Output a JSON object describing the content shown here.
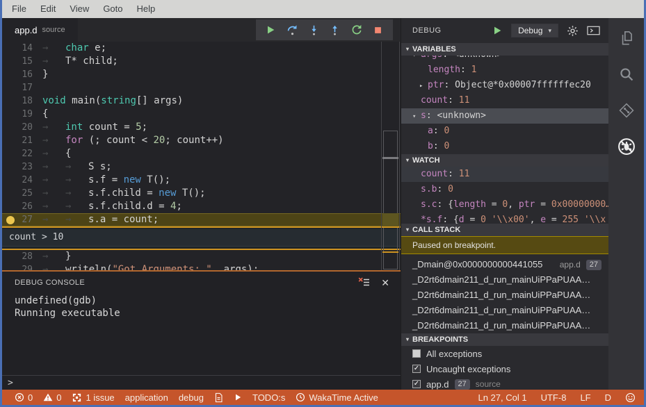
{
  "window": {
    "menu_items": [
      "File",
      "Edit",
      "View",
      "Goto",
      "Help"
    ]
  },
  "editor": {
    "tab": {
      "name": "app.d",
      "type": "source"
    },
    "tab_glyph": "→",
    "toolbar_buttons": [
      "continue",
      "step-over",
      "step-into",
      "step-out",
      "restart",
      "stop"
    ],
    "condition_widget": {
      "expression": "count > 10"
    },
    "code_lines": [
      {
        "num": 14,
        "indent": 1,
        "tokens": [
          {
            "t": "char",
            "c": "kw"
          },
          {
            "t": " e;",
            "c": "pl"
          }
        ]
      },
      {
        "num": 15,
        "indent": 1,
        "tokens": [
          {
            "t": "T* child;",
            "c": "pl"
          }
        ]
      },
      {
        "num": 16,
        "indent": 0,
        "tokens": [
          {
            "t": "}",
            "c": "pl"
          }
        ]
      },
      {
        "num": 17,
        "indent": 0,
        "tokens": []
      },
      {
        "num": 18,
        "indent": 0,
        "tokens": [
          {
            "t": "void",
            "c": "kw"
          },
          {
            "t": " main(",
            "c": "pl"
          },
          {
            "t": "string",
            "c": "kw"
          },
          {
            "t": "[] args)",
            "c": "pl"
          }
        ]
      },
      {
        "num": 19,
        "indent": 0,
        "tokens": [
          {
            "t": "{",
            "c": "pl"
          }
        ]
      },
      {
        "num": 20,
        "indent": 1,
        "tokens": [
          {
            "t": "int",
            "c": "kw"
          },
          {
            "t": " count = ",
            "c": "pl"
          },
          {
            "t": "5",
            "c": "num"
          },
          {
            "t": ";",
            "c": "pl"
          }
        ]
      },
      {
        "num": 21,
        "indent": 1,
        "tokens": [
          {
            "t": "for",
            "c": "ctrl"
          },
          {
            "t": " (; count < ",
            "c": "pl"
          },
          {
            "t": "20",
            "c": "num"
          },
          {
            "t": "; count++)",
            "c": "pl"
          }
        ]
      },
      {
        "num": 22,
        "indent": 1,
        "tokens": [
          {
            "t": "{",
            "c": "pl"
          }
        ]
      },
      {
        "num": 23,
        "indent": 2,
        "tokens": [
          {
            "t": "S s;",
            "c": "pl"
          }
        ]
      },
      {
        "num": 24,
        "indent": 2,
        "tokens": [
          {
            "t": "s.f = ",
            "c": "pl"
          },
          {
            "t": "new",
            "c": "new"
          },
          {
            "t": " T();",
            "c": "pl"
          }
        ]
      },
      {
        "num": 25,
        "indent": 2,
        "tokens": [
          {
            "t": "s.f.child = ",
            "c": "pl"
          },
          {
            "t": "new",
            "c": "new"
          },
          {
            "t": " T();",
            "c": "pl"
          }
        ]
      },
      {
        "num": 26,
        "indent": 2,
        "tokens": [
          {
            "t": "s.f.child.d = ",
            "c": "pl"
          },
          {
            "t": "4",
            "c": "num"
          },
          {
            "t": ";",
            "c": "pl"
          }
        ]
      },
      {
        "num": 27,
        "indent": 2,
        "current": true,
        "breakpoint": true,
        "widget_after": true,
        "tokens": [
          {
            "t": "s.a = count;",
            "c": "pl"
          }
        ]
      },
      {
        "num": 28,
        "indent": 1,
        "tokens": [
          {
            "t": "}",
            "c": "pl"
          }
        ]
      },
      {
        "num": 29,
        "indent": 1,
        "tokens": [
          {
            "t": "writeln(",
            "c": "pl"
          },
          {
            "t": "\"Got Arguments: \"",
            "c": "str"
          },
          {
            "t": ", args);",
            "c": "pl"
          }
        ]
      }
    ]
  },
  "debug_console": {
    "title": "DEBUG CONSOLE",
    "output_lines": [
      "undefined(gdb)",
      "Running executable"
    ],
    "prompt": ">"
  },
  "debug_panel": {
    "title": "DEBUG",
    "config_dropdown": "Debug",
    "sections": {
      "variables": {
        "title": "VARIABLES",
        "rows": [
          {
            "name": "args",
            "value": "<unknown>",
            "value_class": "plain",
            "expand": "expanded",
            "clip": "up"
          },
          {
            "name": "length",
            "value": "1",
            "value_class": "num",
            "depth": 1
          },
          {
            "name": "ptr",
            "value": "Object@*0x00007ffffffec20",
            "value_class": "plain",
            "expand": "collapsed",
            "depth": 1
          },
          {
            "name": "count",
            "value": "11",
            "value_class": "num"
          },
          {
            "name": "s",
            "value": "<unknown>",
            "value_class": "plain",
            "expand": "expanded",
            "selected": true
          },
          {
            "name": "a",
            "value": "0",
            "value_class": "num",
            "depth": 1
          },
          {
            "name": "b",
            "value": "0",
            "value_class": "num",
            "depth": 1
          }
        ]
      },
      "watch": {
        "title": "WATCH",
        "rows": [
          {
            "name": "count",
            "value": "11",
            "value_class": "num",
            "selected2": true
          },
          {
            "name": "s.b",
            "value": "0",
            "value_class": "num"
          },
          {
            "name": "s.c",
            "value_tokens": [
              {
                "t": "{",
                "c": "plain"
              },
              {
                "t": "length",
                "c": "name"
              },
              {
                "t": " = ",
                "c": "plain"
              },
              {
                "t": "0",
                "c": "num"
              },
              {
                "t": ", ",
                "c": "plain"
              },
              {
                "t": "ptr",
                "c": "name"
              },
              {
                "t": " = ",
                "c": "plain"
              },
              {
                "t": "0x00000000…",
                "c": "num"
              }
            ]
          },
          {
            "name": "*s.f",
            "clip": "cut",
            "value_tokens": [
              {
                "t": "{",
                "c": "plain"
              },
              {
                "t": "d",
                "c": "name"
              },
              {
                "t": " = ",
                "c": "plain"
              },
              {
                "t": "0",
                "c": "num"
              },
              {
                "t": " ",
                "c": "plain"
              },
              {
                "t": "'\\\\x00'",
                "c": "num"
              },
              {
                "t": ", ",
                "c": "plain"
              },
              {
                "t": "e",
                "c": "name"
              },
              {
                "t": " = ",
                "c": "plain"
              },
              {
                "t": "255",
                "c": "num"
              },
              {
                "t": " ",
                "c": "plain"
              },
              {
                "t": "'\\\\x",
                "c": "num"
              }
            ]
          }
        ]
      },
      "call_stack": {
        "title": "CALL STACK",
        "status_message": "Paused on breakpoint.",
        "frames": [
          {
            "function": "_Dmain@0x0000000000441055",
            "file": "app.d",
            "line": "27"
          },
          {
            "function": "_D2rt6dmain211_d_run_mainUiPPaPUAA…"
          },
          {
            "function": "_D2rt6dmain211_d_run_mainUiPPaPUAA…"
          },
          {
            "function": "_D2rt6dmain211_d_run_mainUiPPaPUAA…"
          },
          {
            "function": "_D2rt6dmain211_d_run_mainUiPPaPUAA…"
          }
        ]
      },
      "breakpoints": {
        "title": "BREAKPOINTS",
        "items": [
          {
            "label": "All exceptions",
            "checked": false
          },
          {
            "label": "Uncaught exceptions",
            "checked": true
          },
          {
            "label": "app.d",
            "checked": true,
            "badge": "27",
            "detail": "source"
          }
        ]
      }
    }
  },
  "activity_bar": {
    "icons": [
      {
        "name": "files",
        "active": false
      },
      {
        "name": "search",
        "active": false
      },
      {
        "name": "git",
        "active": false
      },
      {
        "name": "debug",
        "active": true
      }
    ]
  },
  "status_bar": {
    "left": [
      {
        "icon": "error-circle",
        "text": "0"
      },
      {
        "icon": "warning",
        "text": "0"
      },
      {
        "icon": "issues",
        "text": "1 issue"
      },
      {
        "text": "application"
      },
      {
        "text": "debug"
      },
      {
        "icon": "file"
      },
      {
        "icon": "play"
      },
      {
        "text": "TODO:s"
      },
      {
        "icon": "clock",
        "text": "WakaTime Active"
      }
    ],
    "right": [
      {
        "text": "Ln 27, Col 1"
      },
      {
        "text": "UTF-8"
      },
      {
        "text": "LF"
      },
      {
        "text": "D"
      },
      {
        "icon": "smiley"
      }
    ]
  },
  "colors": {
    "window_border": "#4a6fb5",
    "status_bar": "#c5552b",
    "breakpoint_dot": "#ecc64f",
    "current_line_bg": "#4d4416",
    "condition_border": "#cf9420",
    "paused_banner_bg": "#564a12",
    "keyword": "#4ec9b0",
    "control_keyword": "#c586c0",
    "new_keyword": "#569cd6",
    "number": "#b5cea8",
    "string": "#ce9178",
    "variable_name": "#c586c0",
    "value_number": "#ce9178"
  }
}
